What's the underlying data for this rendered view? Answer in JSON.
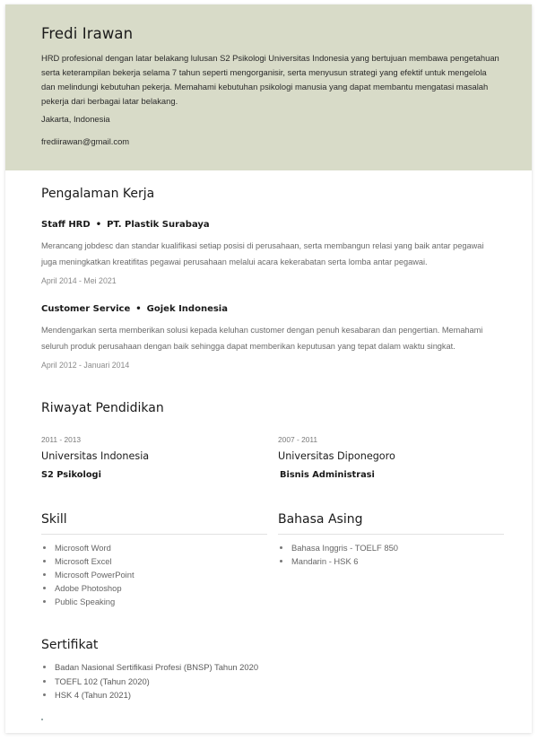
{
  "profile": {
    "name": "Fredi Irawan",
    "summary": "HRD profesional dengan latar belakang lulusan S2 Psikologi Universitas Indonesia yang bertujuan membawa pengetahuan serta keterampilan bekerja selama 7 tahun seperti mengorganisir, serta menyusun strategi yang efektif untuk mengelola dan melindungi kebutuhan pekerja. Memahami kebutuhan psikologi manusia yang dapat membantu mengatasi masalah pekerja dari berbagai latar belakang.",
    "location": "Jakarta, Indonesia",
    "email": "frediirawan@gmail.com",
    "header_color": "#d8dbc8"
  },
  "experience": {
    "title": "Pengalaman Kerja",
    "separator": "•",
    "jobs": [
      {
        "position": "Staff HRD",
        "company": "PT. Plastik Surabaya",
        "description": "Merancang jobdesc dan standar kualifikasi setiap posisi di perusahaan, serta membangun relasi yang baik antar pegawai juga meningkatkan kreatifitas pegawai perusahaan melalui acara kekerabatan serta lomba antar pegawai.",
        "period": "April 2014 - Mei 2021"
      },
      {
        "position": "Customer Service",
        "company": "Gojek Indonesia",
        "description": "Mendengarkan serta memberikan solusi kepada keluhan customer dengan penuh kesabaran dan pengertian. Memahami seluruh produk perusahaan dengan baik sehingga dapat memberikan keputusan yang tepat dalam waktu singkat.",
        "period": "April 2012 - Januari 2014"
      }
    ]
  },
  "education": {
    "title": "Riwayat Pendidikan",
    "items": [
      {
        "years": "2011 - 2013",
        "school": "Universitas Indonesia",
        "major": "S2 Psikologi"
      },
      {
        "years": "2007 - 2011",
        "school": "Universitas Diponegoro",
        "major": "Bisnis Administrasi"
      }
    ]
  },
  "skills": {
    "title": "Skill",
    "items": [
      "Microsoft Word",
      "Microsoft Excel",
      "Microsoft PowerPoint",
      "Adobe Photoshop",
      "Public Speaking"
    ]
  },
  "languages": {
    "title": "Bahasa Asing",
    "items": [
      "Bahasa Inggris - TOELF 850",
      "Mandarin - HSK 6"
    ]
  },
  "certificates": {
    "title": "Sertifikat",
    "items": [
      "Badan Nasional Sertifikasi Profesi (BNSP) Tahun 2020",
      "TOEFL 102 (Tahun 2020)",
      "HSK 4 (Tahun 2021)"
    ]
  },
  "footer": {
    "trailing_text": "."
  }
}
